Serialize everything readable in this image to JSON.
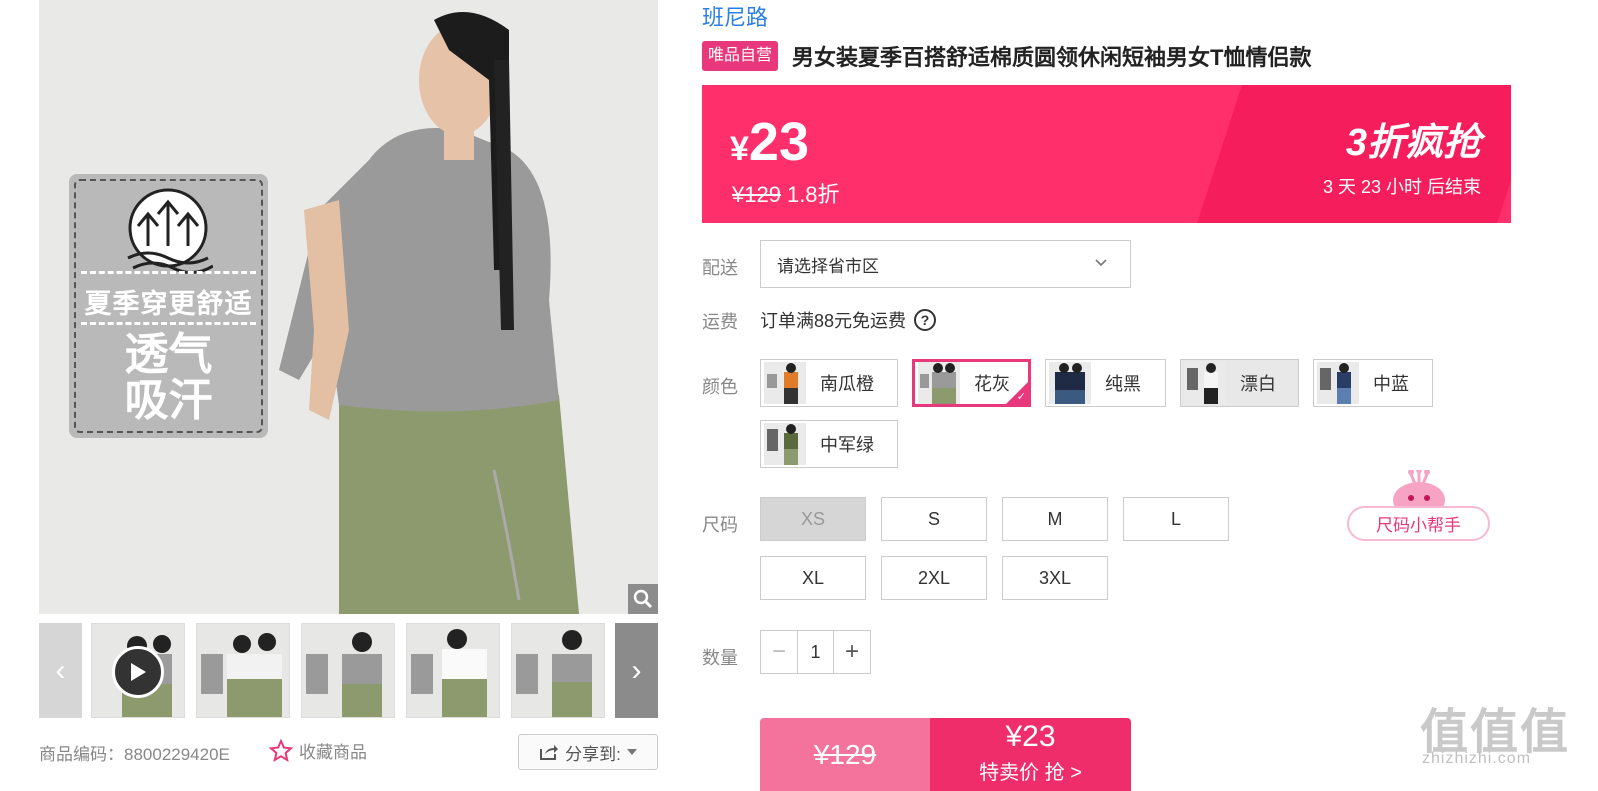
{
  "gallery": {
    "badge_line1": "夏季穿更舒适",
    "badge_line2a": "透气",
    "badge_line2b": "吸汗",
    "prev_arrow": "‹",
    "next_arrow": "›",
    "thumb_count": 5
  },
  "product_code": {
    "label": "商品编码：",
    "value": "8800229420E"
  },
  "favorite_label": "收藏商品",
  "share_label": "分享到:",
  "brand": "班尼路",
  "vip_tag": "唯品自营",
  "title": "男女装夏季百搭舒适棉质圆领休闲短袖男女T恤情侣款",
  "price": {
    "currency": "¥",
    "current": "23",
    "original": "¥129",
    "discount": "1.8折",
    "promo_title": "3折疯抢",
    "countdown": "3  天  23  小时  后结束"
  },
  "delivery": {
    "label": "配送",
    "placeholder": "请选择省市区"
  },
  "shipping": {
    "label": "运费",
    "text": "订单满88元免运费",
    "help": "?"
  },
  "color": {
    "label": "颜色",
    "options": [
      "南瓜橙",
      "花灰",
      "纯黑",
      "漂白",
      "中蓝",
      "中军绿"
    ],
    "selected": "花灰"
  },
  "size": {
    "label": "尺码",
    "options": [
      "XS",
      "S",
      "M",
      "L",
      "XL",
      "2XL",
      "3XL"
    ],
    "disabled": [
      "XS"
    ],
    "helper": "尺码小帮手"
  },
  "quantity": {
    "label": "数量",
    "value": "1",
    "minus": "−",
    "plus": "+"
  },
  "buy": {
    "original": "¥129",
    "price": "¥23",
    "action": "特卖价 抢 >"
  },
  "watermark": {
    "big": "值值值",
    "small": "zhizhizhi.com"
  },
  "colors": {
    "accent": "#e8377b",
    "banner": "#ff2f6b",
    "brand_link": "#2d7fe4"
  }
}
